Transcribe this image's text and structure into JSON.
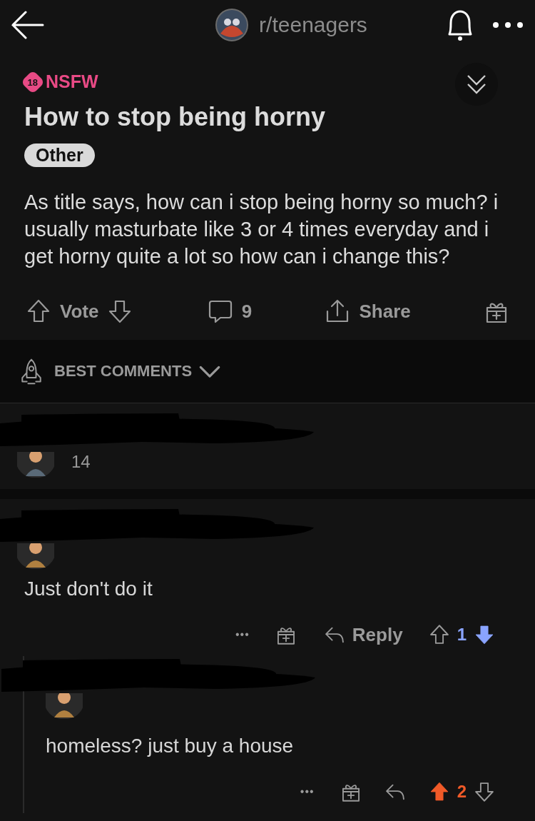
{
  "header": {
    "community": "r/teenagers"
  },
  "post": {
    "nsfw_label": "NSFW",
    "nsfw_badge": "18",
    "title": "How to stop being horny",
    "flair": "Other",
    "body": "As title says, how can i stop being horny so much? i usually masturbate like 3 or 4 times everyday and i get horny quite a lot so how can i change this?",
    "vote_label": "Vote",
    "comment_count": "9",
    "share_label": "Share"
  },
  "sort": {
    "label": "BEST COMMENTS"
  },
  "comments": [
    {
      "kind": "collapsed",
      "score": "14"
    },
    {
      "kind": "comment",
      "body": "Just don't do it",
      "more": "•••",
      "reply_label": "Reply",
      "score": "1",
      "upvoted": false,
      "downvoted": true
    },
    {
      "kind": "reply",
      "body": "homeless? just buy a house",
      "more": "•••",
      "score": "2",
      "upvoted": true,
      "downvoted": false
    }
  ]
}
